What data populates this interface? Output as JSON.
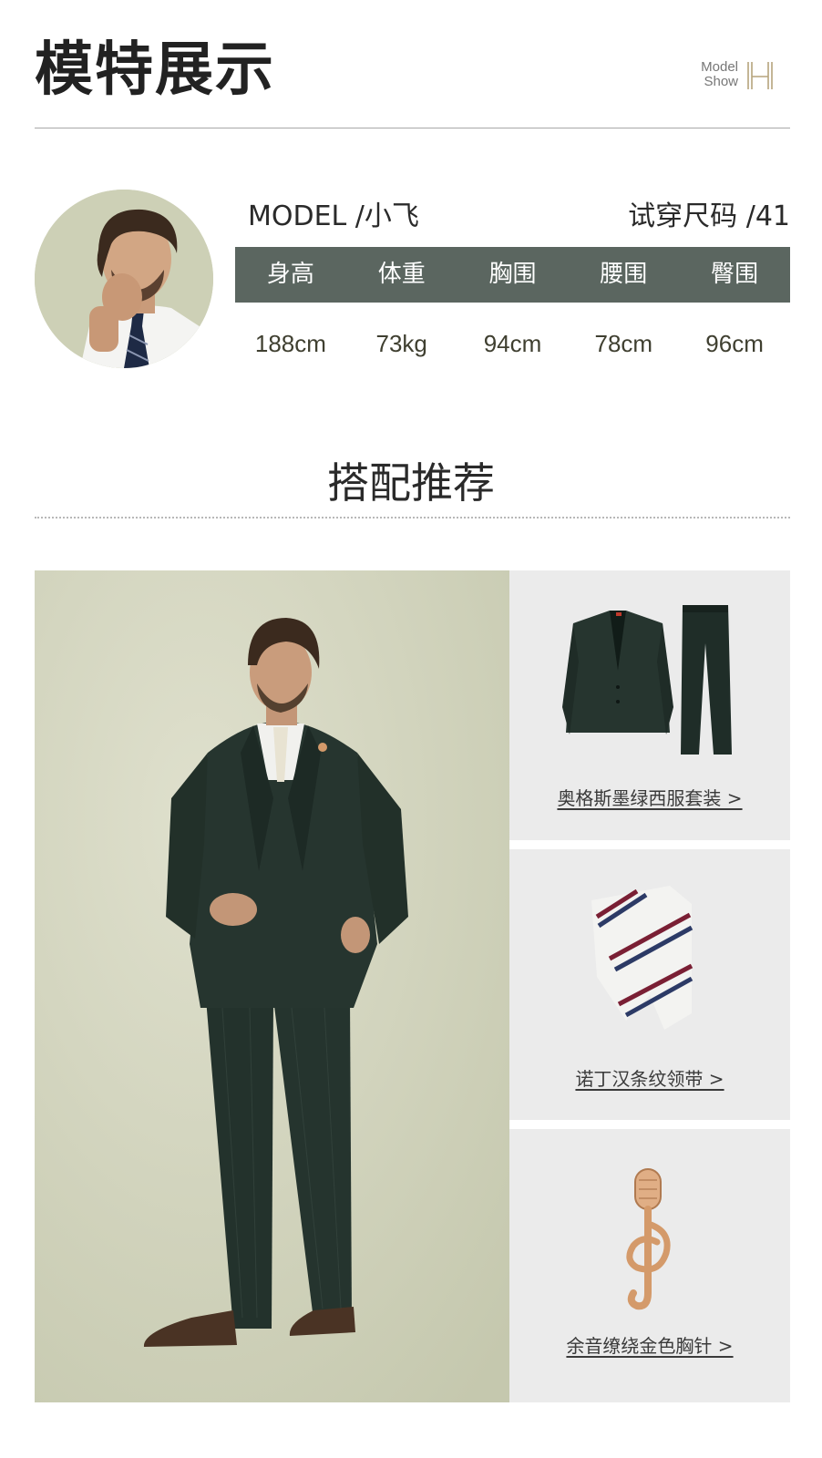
{
  "header": {
    "title": "模特展示",
    "brand_line1": "Model",
    "brand_line2": "Show",
    "brand_icon": "H-monogram-icon"
  },
  "model": {
    "name": "MODEL /小飞",
    "size": "试穿尺码 /41",
    "stats": [
      {
        "label": "身高",
        "value": "188cm"
      },
      {
        "label": "体重",
        "value": "73kg"
      },
      {
        "label": "胸围",
        "value": "94cm"
      },
      {
        "label": "腰围",
        "value": "78cm"
      },
      {
        "label": "臀围",
        "value": "96cm"
      }
    ]
  },
  "recommend": {
    "title": "搭配推荐",
    "items": [
      {
        "label": "奥格斯墨绿西服套装 >",
        "icon": "suit-set-image"
      },
      {
        "label": "诺丁汉条纹领带 >",
        "icon": "striped-tie-image"
      },
      {
        "label": "余音缭绕金色胸针 >",
        "icon": "gold-brooch-image"
      }
    ]
  },
  "colors": {
    "stat_bar": "#5b6660",
    "suit_green": "#26352f",
    "panel_bg": "#ebebeb",
    "photo_bg": "#d2d4bf",
    "brooch_gold": "#d49a6a"
  }
}
